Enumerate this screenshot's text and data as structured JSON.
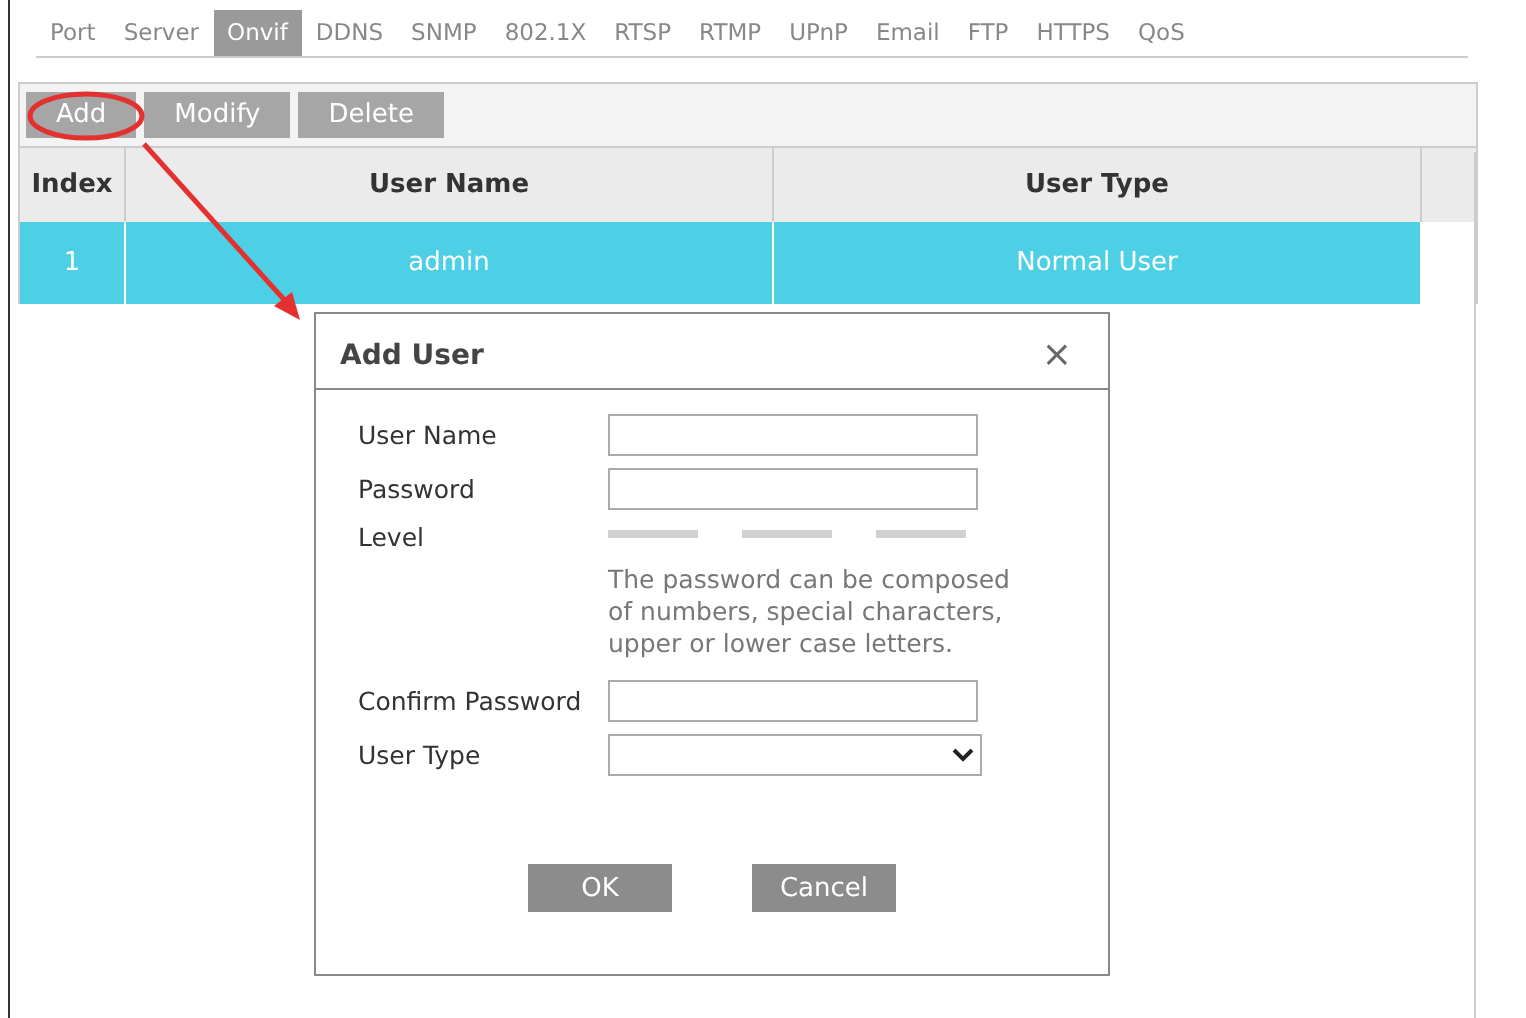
{
  "tabs": [
    {
      "label": "Port",
      "selected": false
    },
    {
      "label": "Server",
      "selected": false
    },
    {
      "label": "Onvif",
      "selected": true
    },
    {
      "label": "DDNS",
      "selected": false
    },
    {
      "label": "SNMP",
      "selected": false
    },
    {
      "label": "802.1X",
      "selected": false
    },
    {
      "label": "RTSP",
      "selected": false
    },
    {
      "label": "RTMP",
      "selected": false
    },
    {
      "label": "UPnP",
      "selected": false
    },
    {
      "label": "Email",
      "selected": false
    },
    {
      "label": "FTP",
      "selected": false
    },
    {
      "label": "HTTPS",
      "selected": false
    },
    {
      "label": "QoS",
      "selected": false
    }
  ],
  "toolbar": [
    "Add",
    "Modify",
    "Delete"
  ],
  "table": {
    "columns": [
      "Index",
      "User Name",
      "User Type"
    ],
    "rows": [
      {
        "cells": [
          "1",
          "admin",
          "Normal User"
        ],
        "selected": true
      }
    ]
  },
  "dialog": {
    "title": "Add User",
    "close": "×",
    "fields": [
      {
        "label": "User Name",
        "kind": "text"
      },
      {
        "label": "Password",
        "kind": "text"
      },
      {
        "label": "Level",
        "kind": "strength",
        "hint": "The password can be composed of numbers, special characters, upper or lower case letters."
      },
      {
        "label": "Confirm Password",
        "kind": "text"
      },
      {
        "label": "User Type",
        "kind": "select"
      }
    ],
    "buttons": [
      "OK",
      "Cancel"
    ]
  }
}
